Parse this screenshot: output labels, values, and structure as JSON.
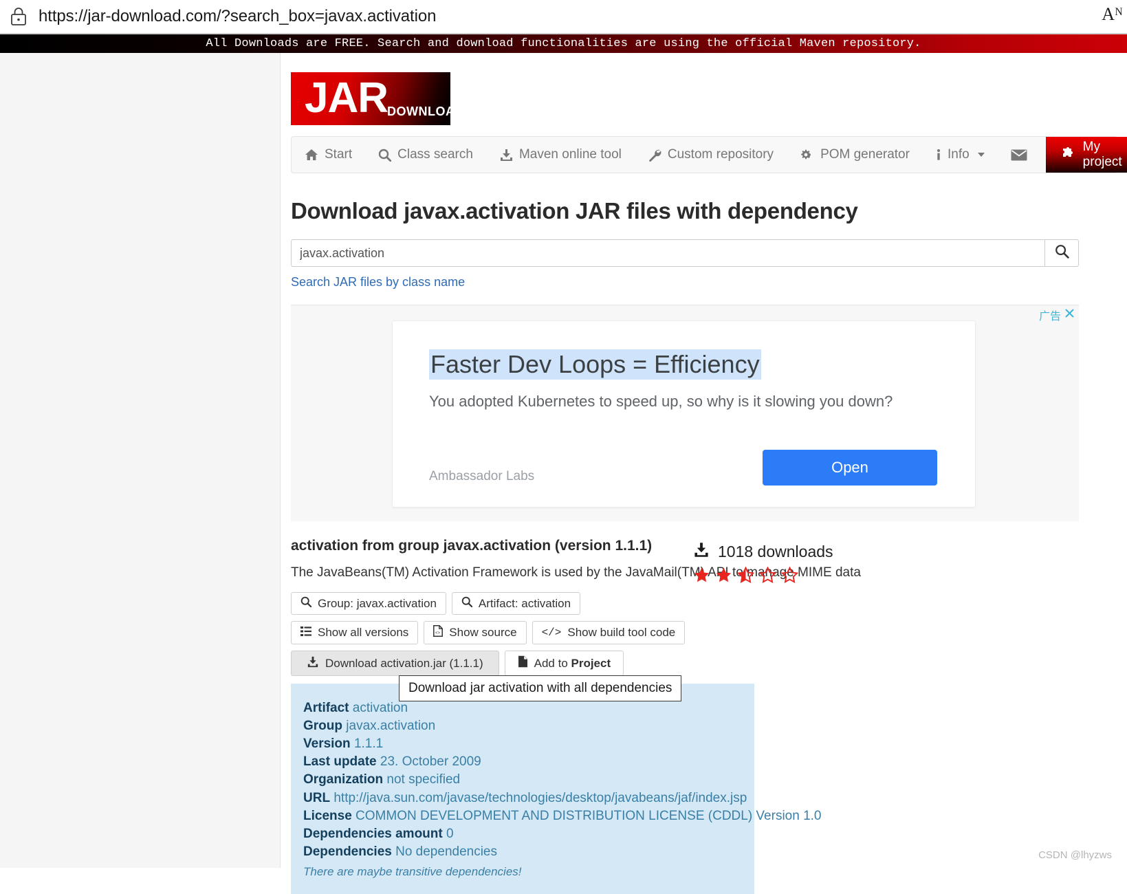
{
  "browser": {
    "url": "https://jar-download.com/?search_box=javax.activation",
    "lock_icon": "lock-icon",
    "reader_icon": "Aᴺ"
  },
  "notice": {
    "text": "All Downloads are FREE. Search and download functionalities are using the official Maven repository."
  },
  "logo": {
    "primary": "JAR",
    "secondary": "DOWNLOAD"
  },
  "nav": {
    "items": [
      {
        "label": "Start",
        "icon": "home-icon"
      },
      {
        "label": "Class search",
        "icon": "search-icon"
      },
      {
        "label": "Maven online tool",
        "icon": "download-icon"
      },
      {
        "label": "Custom repository",
        "icon": "wrench-icon"
      },
      {
        "label": "POM generator",
        "icon": "gears-icon"
      },
      {
        "label": "Info",
        "icon": "info-icon"
      },
      {
        "label": "",
        "icon": "envelope-icon"
      }
    ],
    "my_project": {
      "label": "My project",
      "icon": "puzzle-piece-icon"
    }
  },
  "heading": "Download javax.activation JAR files with dependency",
  "search": {
    "value": "javax.activation",
    "placeholder": "javax.activation",
    "button_icon": "search-icon",
    "class_search_link": "Search JAR files by class name"
  },
  "ad": {
    "label": "广告",
    "close_icon": "close-icon",
    "headline": "Faster Dev Loops = Efficiency",
    "subtext": "You adopted Kubernetes to speed up, so why is it slowing you down?",
    "advertiser": "Ambassador Labs",
    "cta": "Open",
    "cta_color": "#2b7cf6"
  },
  "result": {
    "title": "activation from group javax.activation (version 1.1.1)",
    "description": "The JavaBeans(TM) Activation Framework is used by the JavaMail(TM) API to manage MIME data",
    "buttons_row1": [
      {
        "label": "Group: javax.activation",
        "icon": "search-icon"
      },
      {
        "label": "Artifact: activation",
        "icon": "search-icon"
      }
    ],
    "buttons_row2": [
      {
        "label": "Show all versions",
        "icon": "list-icon"
      },
      {
        "label": "Show source",
        "icon": "file-code-icon"
      },
      {
        "label": "Show build tool code",
        "icon": "code-icon"
      }
    ],
    "buttons_row3": [
      {
        "label": "Download activation.jar (1.1.1)",
        "icon": "download-icon",
        "hover": true
      },
      {
        "label_prefix": "Add to ",
        "label_bold": "Project",
        "icon": "file-icon"
      }
    ],
    "downloads": {
      "count": "1018 downloads",
      "icon": "download-icon"
    },
    "rating": {
      "value": 2.5,
      "max": 5,
      "color": "#e8251f"
    },
    "tooltip": "Download jar activation with all dependencies",
    "info": [
      {
        "key": "Artifact",
        "value": "activation"
      },
      {
        "key": "Group",
        "value": "javax.activation"
      },
      {
        "key": "Version",
        "value": "1.1.1"
      },
      {
        "key": "Last update",
        "value": "23. October 2009"
      },
      {
        "key": "Organization",
        "value": "not specified"
      },
      {
        "key": "URL",
        "value": "http://java.sun.com/javase/technologies/desktop/javabeans/jaf/index.jsp"
      },
      {
        "key": "License",
        "value": "COMMON DEVELOPMENT AND DISTRIBUTION LICENSE (CDDL) Version 1.0"
      },
      {
        "key": "Dependencies amount",
        "value": "0"
      },
      {
        "key": "Dependencies",
        "value": "No dependencies"
      }
    ],
    "info_note": "There are maybe transitive dependencies!"
  },
  "watermark": "CSDN @lhyzws"
}
